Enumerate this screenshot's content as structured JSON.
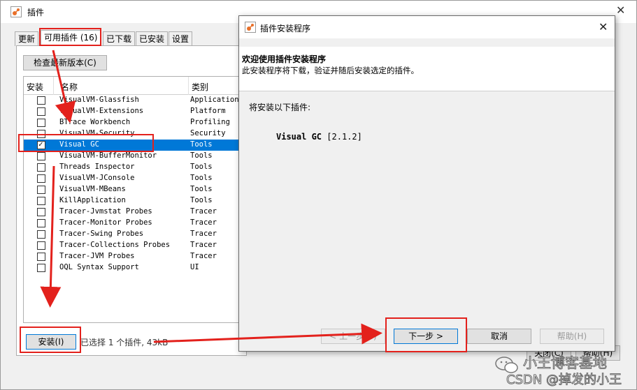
{
  "background_window": {
    "title": "插件",
    "tabs": [
      {
        "label": "更新"
      },
      {
        "label": "可用插件 (16)"
      },
      {
        "label": "已下载"
      },
      {
        "label": "已安装"
      },
      {
        "label": "设置"
      }
    ],
    "check_button": "检查最新版本(C)",
    "columns": {
      "install": "安装",
      "name": "名称",
      "category": "类别"
    },
    "plugins": [
      {
        "name": "VisualVM-Glassfish",
        "category": "Application",
        "checked": false,
        "selected": false
      },
      {
        "name": "VisualVM-Extensions",
        "category": "Platform",
        "checked": false,
        "selected": false
      },
      {
        "name": "BTrace Workbench",
        "category": "Profiling",
        "checked": false,
        "selected": false
      },
      {
        "name": "VisualVM-Security",
        "category": "Security",
        "checked": false,
        "selected": false
      },
      {
        "name": "Visual GC",
        "category": "Tools",
        "checked": true,
        "selected": true
      },
      {
        "name": "VisualVM-BufferMonitor",
        "category": "Tools",
        "checked": false,
        "selected": false
      },
      {
        "name": "Threads Inspector",
        "category": "Tools",
        "checked": false,
        "selected": false
      },
      {
        "name": "VisualVM-JConsole",
        "category": "Tools",
        "checked": false,
        "selected": false
      },
      {
        "name": "VisualVM-MBeans",
        "category": "Tools",
        "checked": false,
        "selected": false
      },
      {
        "name": "KillApplication",
        "category": "Tools",
        "checked": false,
        "selected": false
      },
      {
        "name": "Tracer-Jvmstat Probes",
        "category": "Tracer",
        "checked": false,
        "selected": false
      },
      {
        "name": "Tracer-Monitor Probes",
        "category": "Tracer",
        "checked": false,
        "selected": false
      },
      {
        "name": "Tracer-Swing Probes",
        "category": "Tracer",
        "checked": false,
        "selected": false
      },
      {
        "name": "Tracer-Collections Probes",
        "category": "Tracer",
        "checked": false,
        "selected": false
      },
      {
        "name": "Tracer-JVM Probes",
        "category": "Tracer",
        "checked": false,
        "selected": false
      },
      {
        "name": "OQL Syntax Support",
        "category": "UI",
        "checked": false,
        "selected": false
      }
    ],
    "install_button": "安装(I)",
    "status": "已选择 1 个插件, 43kB",
    "close_button": "关闭(C)",
    "help_button": "帮助(H)"
  },
  "dialog": {
    "title": "插件安装程序",
    "heading": "欢迎使用插件安装程序",
    "subheading": "此安装程序将下载，验证并随后安装选定的插件。",
    "intro": "将安装以下插件:",
    "plugin_name": "Visual GC",
    "plugin_version": "[2.1.2]",
    "buttons": {
      "back": "< 上一步(B)",
      "next": "下一步 >",
      "cancel": "取消",
      "help": "帮助(H)"
    }
  },
  "watermark": {
    "line1": "小王博客基地",
    "line2": "CSDN @掉发的小王"
  },
  "colors": {
    "annotation": "#e3211c",
    "selection": "#0078d7",
    "icon_accent": "#e8702a"
  }
}
